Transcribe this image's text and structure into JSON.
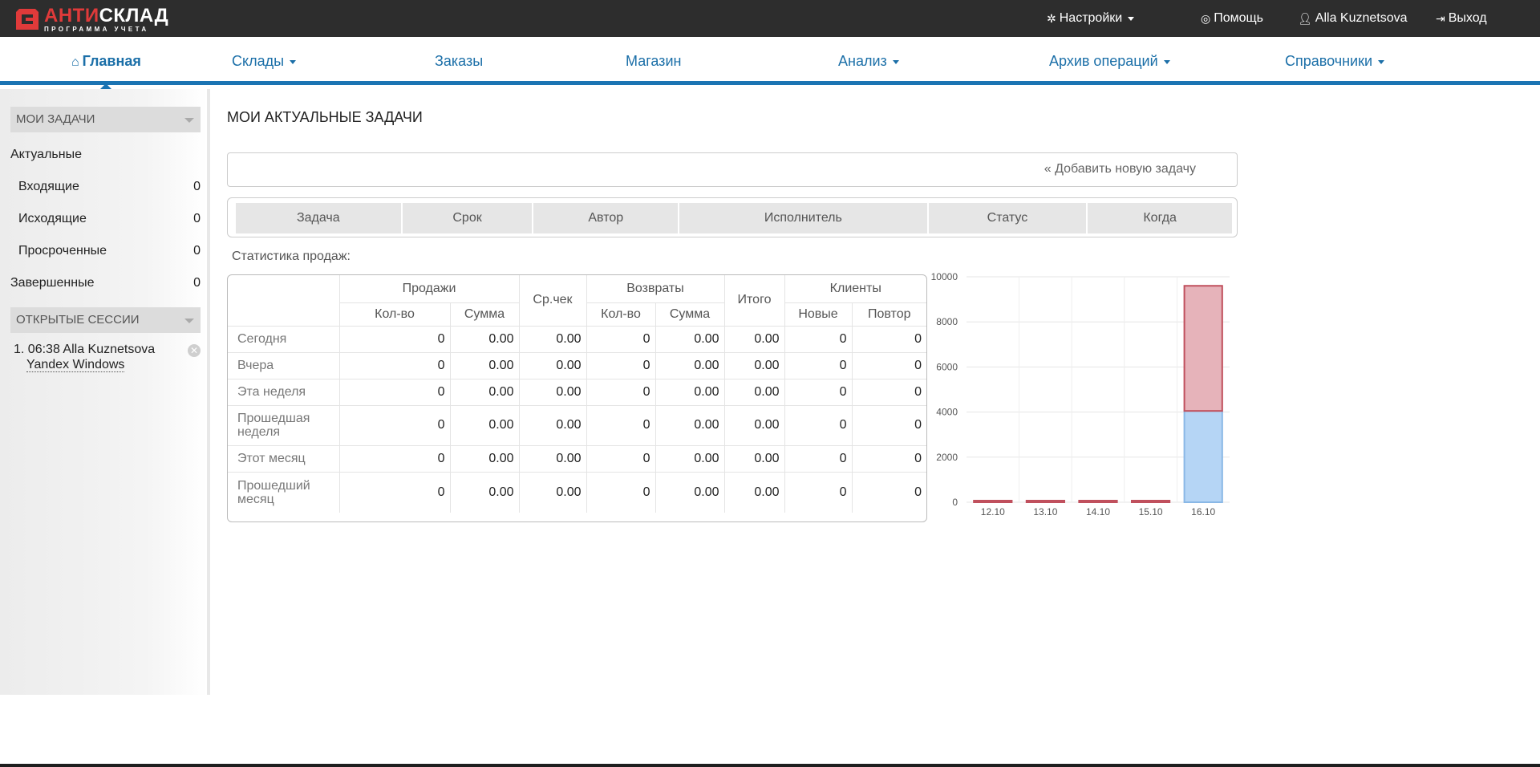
{
  "brand": {
    "name_red": "АНТИ",
    "name_white": "СКЛАД",
    "tagline": "ПРОГРАММА УЧЕТА",
    "accent_color": "#e03a3a",
    "nav_color": "#1b74b3"
  },
  "topbar": {
    "settings_label": "Настройки",
    "settings_icon": "gear-icon",
    "help_label": "Помощь",
    "help_icon": "lifebuoy-icon",
    "user_label": "Alla Kuznetsova",
    "user_icon": "user-icon",
    "logout_label": "Выход",
    "logout_icon": "sign-out-icon"
  },
  "nav": {
    "home": "Главная",
    "warehouses": "Склады",
    "orders": "Заказы",
    "shop": "Магазин",
    "analysis": "Анализ",
    "archive": "Архив операций",
    "references": "Справочники"
  },
  "sidebar": {
    "tasks_header": "МОИ ЗАДАЧИ",
    "current": "Актуальные",
    "incoming": {
      "label": "Входящие",
      "count": "0"
    },
    "outgoing": {
      "label": "Исходящие",
      "count": "0"
    },
    "overdue": {
      "label": "Просроченные",
      "count": "0"
    },
    "completed": {
      "label": "Завершенные",
      "count": "0"
    },
    "sessions_header": "ОТКРЫТЫЕ СЕССИИ",
    "session": {
      "num": "1.",
      "time": "06:38",
      "user": "Alla Kuznetsova",
      "device": "Yandex Windows"
    }
  },
  "main": {
    "title": "МОИ АКТУАЛЬНЫЕ ЗАДАЧИ",
    "add_task": "« Добавить новую задачу",
    "task_columns": [
      "Задача",
      "Срок",
      "Автор",
      "Исполнитель",
      "Статус",
      "Когда"
    ],
    "stats_label": "Статистика продаж:"
  },
  "stats": {
    "groups": {
      "sales": "Продажи",
      "avg_check": "Ср.чек",
      "returns": "Возвраты",
      "total": "Итого",
      "clients": "Клиенты"
    },
    "sub": {
      "qty": "Кол-во",
      "sum": "Сумма",
      "new": "Новые",
      "repeat": "Повтор"
    },
    "rows": [
      {
        "label": "Сегодня",
        "sales_qty": "0",
        "sales_sum": "0.00",
        "avg": "0.00",
        "ret_qty": "0",
        "ret_sum": "0.00",
        "total": "0.00",
        "new": "0",
        "repeat": "0"
      },
      {
        "label": "Вчера",
        "sales_qty": "0",
        "sales_sum": "0.00",
        "avg": "0.00",
        "ret_qty": "0",
        "ret_sum": "0.00",
        "total": "0.00",
        "new": "0",
        "repeat": "0"
      },
      {
        "label": "Эта неделя",
        "sales_qty": "0",
        "sales_sum": "0.00",
        "avg": "0.00",
        "ret_qty": "0",
        "ret_sum": "0.00",
        "total": "0.00",
        "new": "0",
        "repeat": "0"
      },
      {
        "label": "Прошедшая неделя",
        "sales_qty": "0",
        "sales_sum": "0.00",
        "avg": "0.00",
        "ret_qty": "0",
        "ret_sum": "0.00",
        "total": "0.00",
        "new": "0",
        "repeat": "0"
      },
      {
        "label": "Этот месяц",
        "sales_qty": "0",
        "sales_sum": "0.00",
        "avg": "0.00",
        "ret_qty": "0",
        "ret_sum": "0.00",
        "total": "0.00",
        "new": "0",
        "repeat": "0"
      },
      {
        "label": "Прошедший месяц",
        "sales_qty": "0",
        "sales_sum": "0.00",
        "avg": "0.00",
        "ret_qty": "0",
        "ret_sum": "0.00",
        "total": "0.00",
        "new": "0",
        "repeat": "0"
      }
    ]
  },
  "chart_data": {
    "type": "bar",
    "categories": [
      "12.10",
      "13.10",
      "14.10",
      "15.10",
      "16.10"
    ],
    "series": [
      {
        "values": [
          0,
          0,
          0,
          0,
          4050
        ],
        "color": "#b5d5f5",
        "stroke": "#8ab8e6"
      },
      {
        "values": [
          0,
          0,
          0,
          0,
          5550
        ],
        "color": "#e6b3ba",
        "stroke": "#c0505d"
      }
    ],
    "stacked": true,
    "ylim": [
      0,
      10000
    ],
    "yticks": [
      0,
      2000,
      4000,
      6000,
      8000,
      10000
    ],
    "grid": true
  }
}
